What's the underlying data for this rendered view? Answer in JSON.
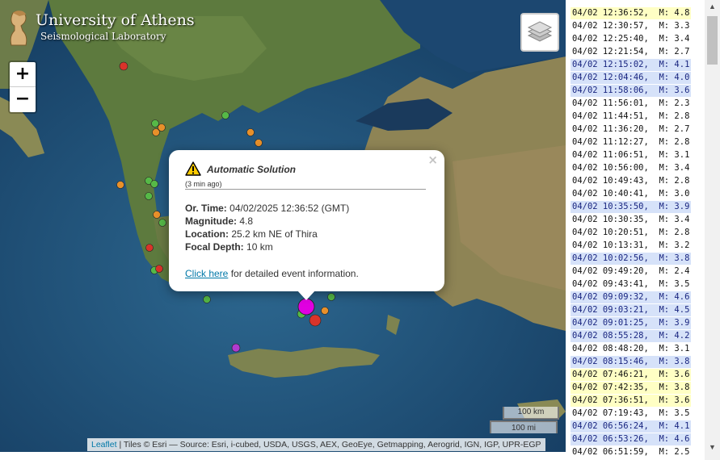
{
  "logo": {
    "line1": "University of Athens",
    "line2": "Seismological Laboratory"
  },
  "zoom": {
    "in_label": "+",
    "out_label": "−"
  },
  "popup": {
    "close_label": "×",
    "title": "Automatic Solution",
    "ago": "(3 min ago)",
    "or_time_label": "Or. Time:",
    "or_time_value": "04/02/2025 12:36:52 (GMT)",
    "magnitude_label": "Magnitude:",
    "magnitude_value": "4.8",
    "location_label": "Location:",
    "location_value": "25.2 km NE of Thira",
    "depth_label": "Focal Depth:",
    "depth_value": "10 km",
    "link_text": "Click here",
    "link_suffix": "for detailed event information."
  },
  "scale": {
    "km": "100 km",
    "mi": "100 mi"
  },
  "attribution": {
    "leaflet": "Leaflet",
    "text": "| Tiles © Esri — Source: Esri, i-cubed, USDA, USGS, AEX, GeoEye, Getmapping, Aerogrid, IGN, IGP, UPR-EGP"
  },
  "colors": {
    "yellow_highlight": "#ffffc4",
    "blue_highlight": "#d6e2f9",
    "link": "#0078a8",
    "recent_event": "#e100e1"
  },
  "events": [
    {
      "label": "04/02 12:36:52,  M: 4.8",
      "sev": "yellow"
    },
    {
      "label": "04/02 12:30:57,  M: 3.3",
      "sev": "none"
    },
    {
      "label": "04/02 12:25:40,  M: 3.4",
      "sev": "none"
    },
    {
      "label": "04/02 12:21:54,  M: 2.7",
      "sev": "none"
    },
    {
      "label": "04/02 12:15:02,  M: 4.1",
      "sev": "blue"
    },
    {
      "label": "04/02 12:04:46,  M: 4.0",
      "sev": "blue"
    },
    {
      "label": "04/02 11:58:06,  M: 3.6",
      "sev": "blue"
    },
    {
      "label": "04/02 11:56:01,  M: 2.3",
      "sev": "none"
    },
    {
      "label": "04/02 11:44:51,  M: 2.8",
      "sev": "none"
    },
    {
      "label": "04/02 11:36:20,  M: 2.7",
      "sev": "none"
    },
    {
      "label": "04/02 11:12:27,  M: 2.8",
      "sev": "none"
    },
    {
      "label": "04/02 11:06:51,  M: 3.1",
      "sev": "none"
    },
    {
      "label": "04/02 10:56:00,  M: 3.4",
      "sev": "none"
    },
    {
      "label": "04/02 10:49:43,  M: 2.8",
      "sev": "none"
    },
    {
      "label": "04/02 10:40:41,  M: 3.0",
      "sev": "none"
    },
    {
      "label": "04/02 10:35:50,  M: 3.9",
      "sev": "blue"
    },
    {
      "label": "04/02 10:30:35,  M: 3.4",
      "sev": "none"
    },
    {
      "label": "04/02 10:20:51,  M: 2.8",
      "sev": "none"
    },
    {
      "label": "04/02 10:13:31,  M: 3.2",
      "sev": "none"
    },
    {
      "label": "04/02 10:02:56,  M: 3.8",
      "sev": "blue"
    },
    {
      "label": "04/02 09:49:20,  M: 2.4",
      "sev": "none"
    },
    {
      "label": "04/02 09:43:41,  M: 3.5",
      "sev": "none"
    },
    {
      "label": "04/02 09:09:32,  M: 4.6",
      "sev": "blue"
    },
    {
      "label": "04/02 09:03:21,  M: 4.5",
      "sev": "blue"
    },
    {
      "label": "04/02 09:01:25,  M: 3.9",
      "sev": "blue"
    },
    {
      "label": "04/02 08:55:28,  M: 4.2",
      "sev": "blue"
    },
    {
      "label": "04/02 08:48:20,  M: 3.1",
      "sev": "none"
    },
    {
      "label": "04/02 08:15:46,  M: 3.8",
      "sev": "blue"
    },
    {
      "label": "04/02 07:46:21,  M: 3.6",
      "sev": "yellow"
    },
    {
      "label": "04/02 07:42:35,  M: 3.8",
      "sev": "yellow"
    },
    {
      "label": "04/02 07:36:51,  M: 3.6",
      "sev": "yellow"
    },
    {
      "label": "04/02 07:19:43,  M: 3.5",
      "sev": "none"
    },
    {
      "label": "04/02 06:56:24,  M: 4.1",
      "sev": "blue"
    },
    {
      "label": "04/02 06:53:26,  M: 4.6",
      "sev": "blue"
    },
    {
      "label": "04/02 06:51:59,  M: 2.5",
      "sev": "none"
    }
  ]
}
